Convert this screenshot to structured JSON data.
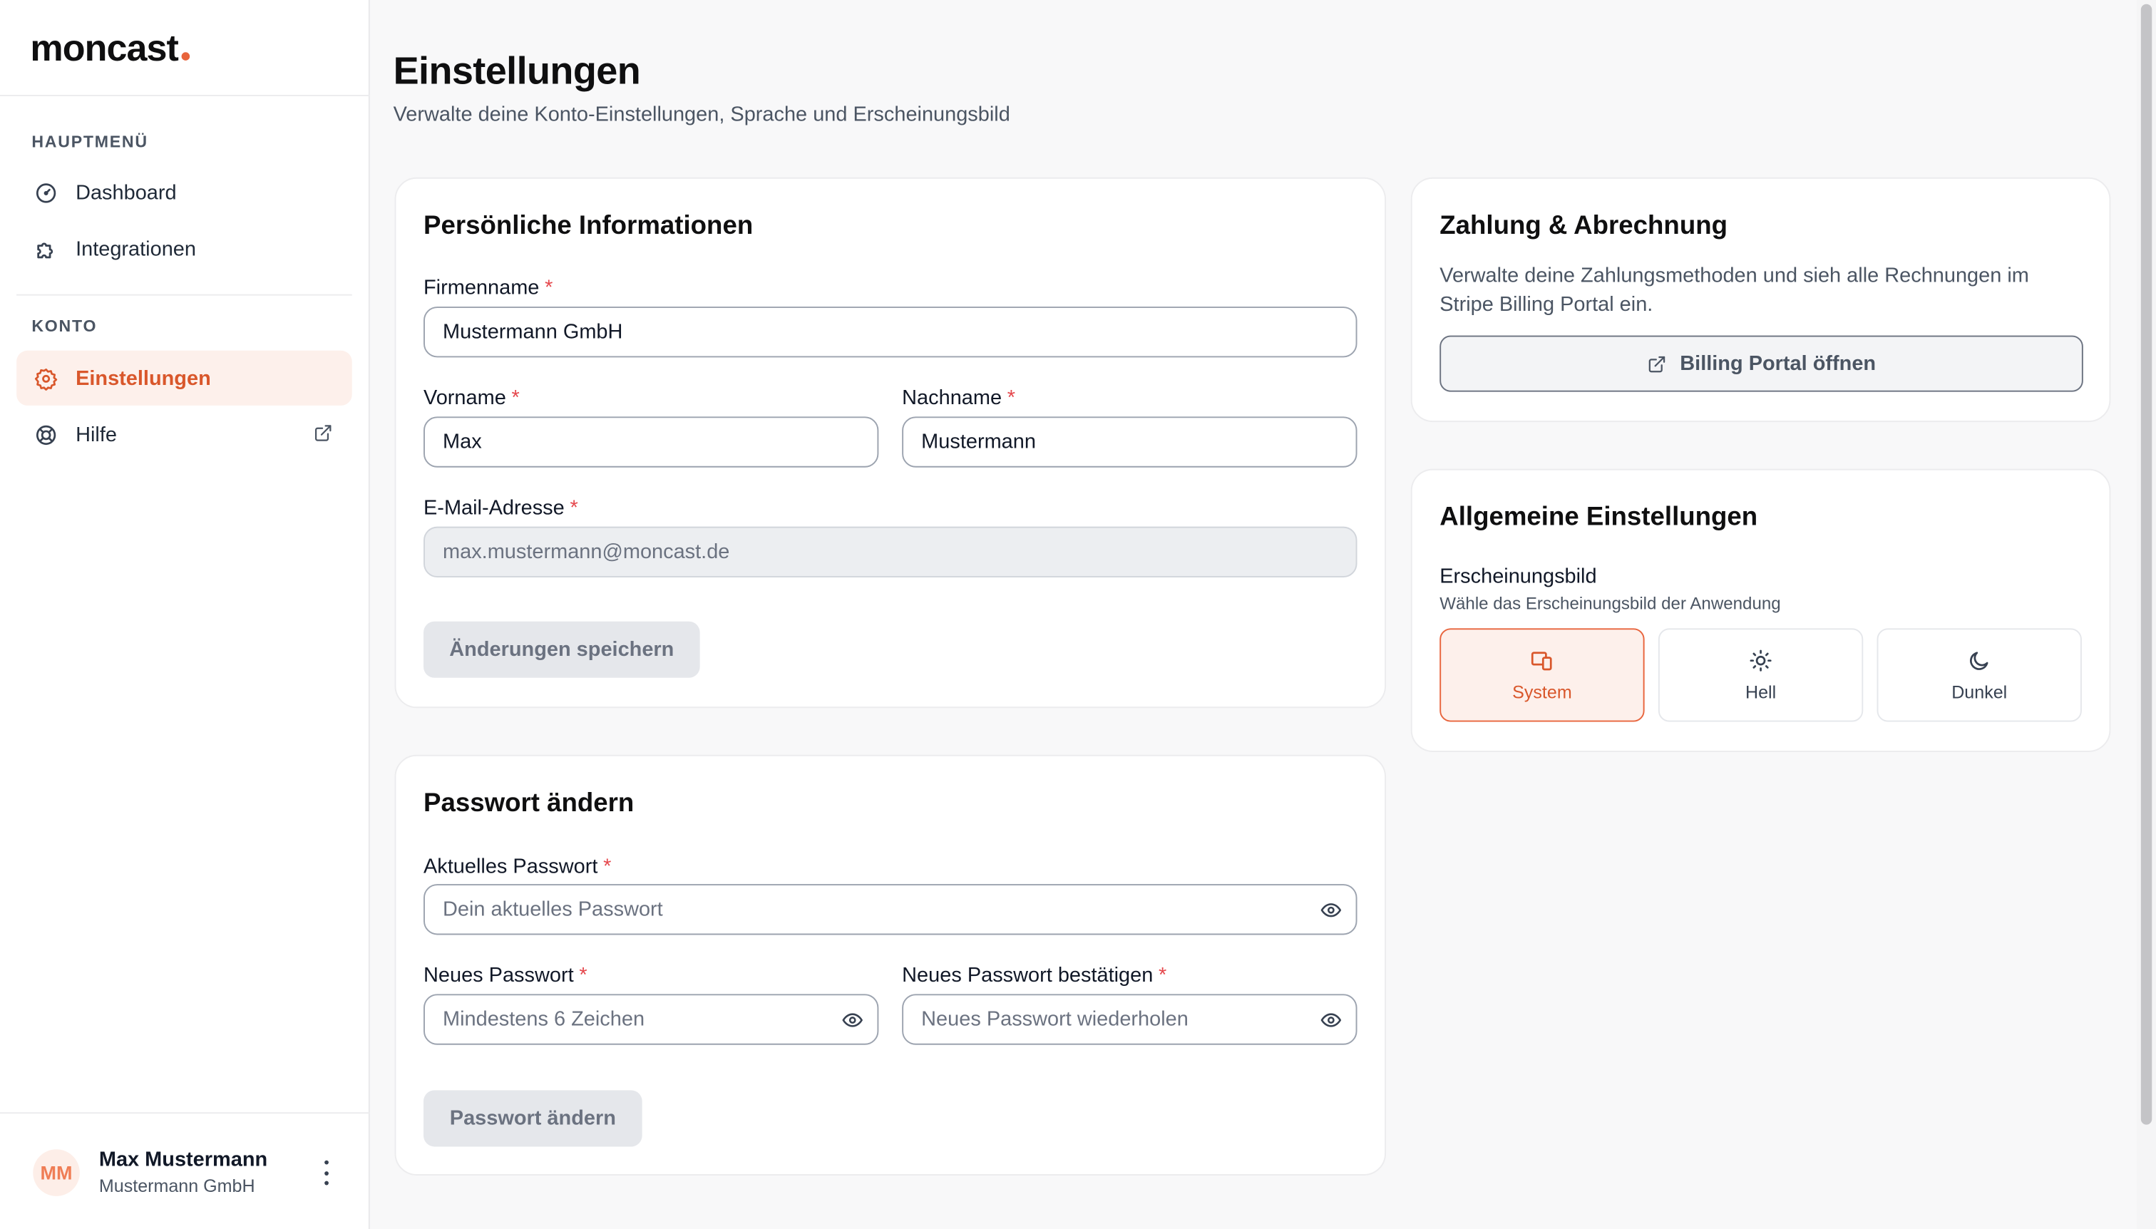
{
  "brand": {
    "name": "moncast",
    "accent": "#e8643c"
  },
  "sidebar": {
    "main_label": "HAUPTMENÜ",
    "main_items": [
      {
        "label": "Dashboard",
        "icon": "gauge-icon"
      },
      {
        "label": "Integrationen",
        "icon": "puzzle-icon"
      }
    ],
    "account_label": "KONTO",
    "account_items": [
      {
        "label": "Einstellungen",
        "icon": "gear-icon",
        "active": true
      },
      {
        "label": "Hilfe",
        "icon": "lifebuoy-icon",
        "external": true
      }
    ],
    "user": {
      "initials": "MM",
      "name": "Max Mustermann",
      "company": "Mustermann GmbH"
    }
  },
  "header": {
    "title": "Einstellungen",
    "subtitle": "Verwalte deine Konto-Einstellungen, Sprache und Erscheinungsbild"
  },
  "personal": {
    "title": "Persönliche Informationen",
    "company_label": "Firmenname",
    "company_value": "Mustermann GmbH",
    "firstname_label": "Vorname",
    "firstname_value": "Max",
    "lastname_label": "Nachname",
    "lastname_value": "Mustermann",
    "email_label": "E-Mail-Adresse",
    "email_placeholder": "max.mustermann@moncast.de",
    "required_mark": "*",
    "save_label": "Änderungen speichern"
  },
  "password": {
    "title": "Passwort ändern",
    "current_label": "Aktuelles Passwort",
    "current_placeholder": "Dein aktuelles Passwort",
    "new_label": "Neues Passwort",
    "new_placeholder": "Mindestens 6 Zeichen",
    "confirm_label": "Neues Passwort bestätigen",
    "confirm_placeholder": "Neues Passwort wiederholen",
    "submit_label": "Passwort ändern"
  },
  "billing": {
    "title": "Zahlung & Abrechnung",
    "description": "Verwalte deine Zahlungsmethoden und sieh alle Rechnungen im Stripe Billing Portal ein.",
    "button_label": "Billing Portal öffnen"
  },
  "general": {
    "title": "Allgemeine Einstellungen",
    "appearance_label": "Erscheinungsbild",
    "appearance_hint": "Wähle das Erscheinungsbild der Anwendung",
    "options": [
      {
        "label": "System",
        "icon": "devices-icon",
        "selected": true
      },
      {
        "label": "Hell",
        "icon": "sun-icon",
        "selected": false
      },
      {
        "label": "Dunkel",
        "icon": "moon-icon",
        "selected": false
      }
    ]
  }
}
